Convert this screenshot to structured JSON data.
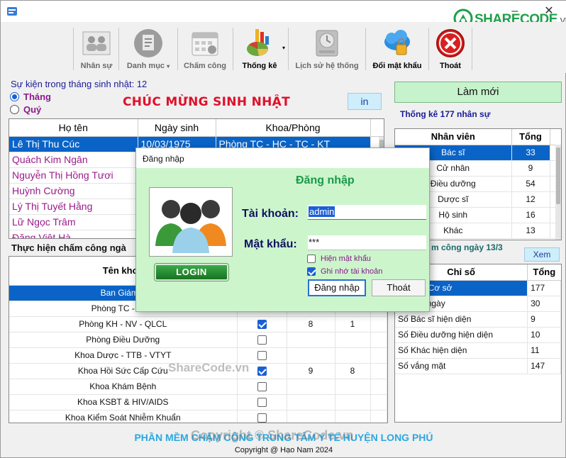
{
  "toolbar": {
    "items": [
      {
        "label": "Nhân sự",
        "icon": "people-group-icon"
      },
      {
        "label": "Danh mục",
        "icon": "clipboard-list-icon"
      },
      {
        "label": "Chấm công",
        "icon": "calendar-icon"
      },
      {
        "label": "Thống kê",
        "icon": "pie-chart-icon"
      },
      {
        "label": "Lịch sử hệ thống",
        "icon": "history-disk-icon"
      },
      {
        "label": "Đổi mật khẩu",
        "icon": "cloud-lock-icon"
      },
      {
        "label": "Thoát",
        "icon": "exit-x-icon"
      }
    ]
  },
  "logo": {
    "brand": "SHARECODE",
    "suffix": ".vn"
  },
  "birthday": {
    "heading": "Sự kiện trong tháng sinh nhật: 12",
    "radio_month": "Tháng",
    "radio_quarter": "Quý",
    "congrats": "CHÚC MỪNG SINH NHẬT",
    "print_button": "in",
    "columns": [
      "Họ tên",
      "Ngày sinh",
      "Khoa/Phòng"
    ],
    "rows": [
      {
        "name": "Lê Thị Thu Cúc",
        "dob": "10/03/1975",
        "dept": "Phòng TC - HC - TC - KT"
      },
      {
        "name": "Quách Kim Ngân",
        "dob": "",
        "dept": ""
      },
      {
        "name": "Nguyễn Thị Hồng Tươi",
        "dob": "",
        "dept": ""
      },
      {
        "name": "Huỳnh Cường",
        "dob": "",
        "dept": ""
      },
      {
        "name": "Lý Thị Tuyết Hằng",
        "dob": "",
        "dept": ""
      },
      {
        "name": "Lữ Ngọc Trâm",
        "dob": "",
        "dept": ""
      },
      {
        "name": "Đặng Việt Hà",
        "dob": "",
        "dept": ""
      }
    ]
  },
  "attendance": {
    "heading": "Thực hiện chấm công ngà",
    "column_header": "Tên khoa",
    "rows": [
      {
        "name": "Ban Giám đ",
        "checked": null,
        "a": "",
        "b": ""
      },
      {
        "name": "Phòng TC - HC -",
        "checked": null,
        "a": "",
        "b": ""
      },
      {
        "name": "Phòng KH - NV - QLCL",
        "checked": true,
        "a": "8",
        "b": "1"
      },
      {
        "name": "Phòng Điều Dưỡng",
        "checked": false,
        "a": "",
        "b": ""
      },
      {
        "name": "Khoa Dược - TTB - VTYT",
        "checked": false,
        "a": "",
        "b": ""
      },
      {
        "name": "Khoa Hồi Sức Cấp Cứu",
        "checked": true,
        "a": "9",
        "b": "8"
      },
      {
        "name": "Khoa Khám Bệnh",
        "checked": false,
        "a": "",
        "b": ""
      },
      {
        "name": "Khoa KSBT & HIV/AIDS",
        "checked": false,
        "a": "",
        "b": ""
      },
      {
        "name": "Khoa Kiểm Soát Nhiễm Khuẩn",
        "checked": false,
        "a": "",
        "b": ""
      }
    ]
  },
  "right": {
    "refresh_button": "Làm mới",
    "stats_heading": "Thống kê 177 nhân sự",
    "stats_columns": [
      "Nhân viên",
      "Tổng"
    ],
    "stats_rows": [
      {
        "role": "Bác sĩ",
        "total": "33"
      },
      {
        "role": "Cử nhân",
        "total": "9"
      },
      {
        "role": "Điều dưỡng",
        "total": "54"
      },
      {
        "role": "Dược sĩ",
        "total": "12"
      },
      {
        "role": "Hộ sinh",
        "total": "16"
      },
      {
        "role": "Khác",
        "total": "13"
      }
    ],
    "att_heading": "m công ngày 13/3",
    "view_button": "Xem",
    "ind_columns": [
      "Chỉ số",
      "Tổng"
    ],
    "ind_rows": [
      {
        "label": "lực của Cơ sở",
        "total": "177"
      },
      {
        "label": "n trong ngày",
        "total": "30"
      },
      {
        "label": "Số Bác sĩ hiện diện",
        "total": "9"
      },
      {
        "label": "Số Điều dưỡng hiện diện",
        "total": "10"
      },
      {
        "label": "Số Khác hiện diện",
        "total": "11"
      },
      {
        "label": "Số vắng mặt",
        "total": "147"
      }
    ]
  },
  "footer": {
    "line1": "PHẦN MỀM CHẤM CÔNG TRUNG TÂM Y TẾ HUYỆN LONG PHÚ",
    "line2": "Copyright @ Hạo Nam 2024"
  },
  "watermarks": {
    "center": "ShareCode.vn",
    "bottom": "Copyright © ShareCode.vn"
  },
  "login": {
    "title": "Đăng nhập",
    "heading": "Đăng nhập",
    "image_button": "LOGIN",
    "username_label": "Tài khoản:",
    "username_value": "admin",
    "password_label": "Mật khẩu:",
    "password_value": "***",
    "show_password": "Hiện mật khẩu",
    "remember": "Ghi nhớ tài khoản",
    "submit": "Đăng nhập",
    "exit": "Thoát"
  }
}
